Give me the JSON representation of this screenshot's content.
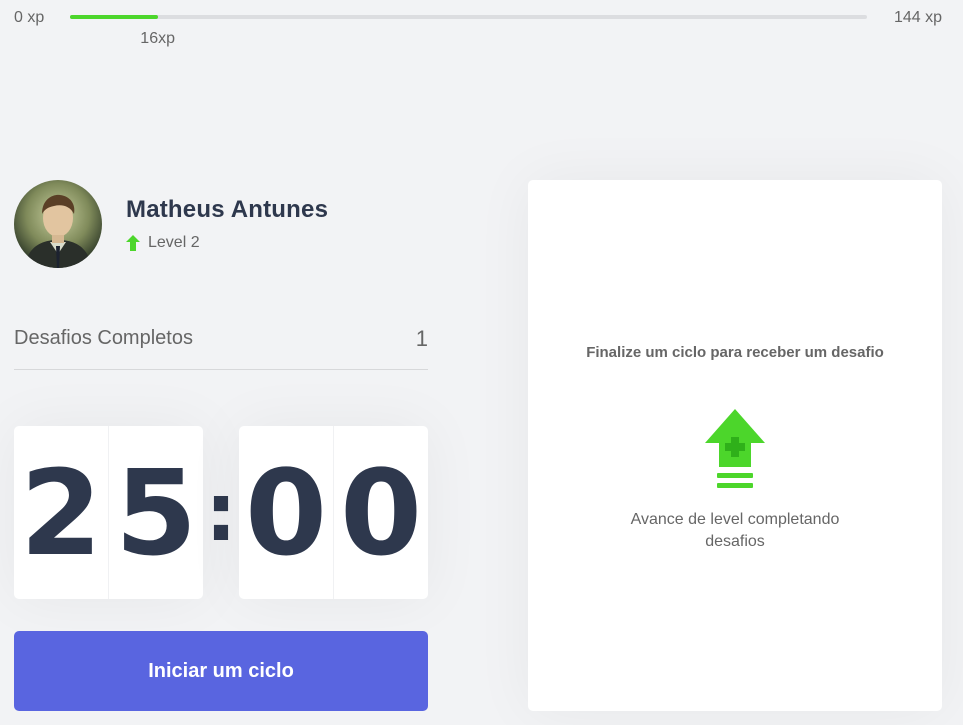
{
  "xp": {
    "min_label": "0 xp",
    "max_label": "144 xp",
    "current_label": "16xp",
    "progress": 0.11
  },
  "profile": {
    "name": "Matheus Antunes",
    "level_label": "Level 2"
  },
  "stats": {
    "completed_label": "Desafios Completos",
    "completed_count": "1"
  },
  "countdown": {
    "minute_left": "2",
    "minute_right": "5",
    "separator": ":",
    "second_left": "0",
    "second_right": "0"
  },
  "actions": {
    "start_label": "Iniciar um ciclo"
  },
  "challenge": {
    "title": "Finalize um ciclo para receber um desafio",
    "description": "Avance de level completando desafios"
  },
  "colors": {
    "accent": "#5965e0",
    "green": "#4cd62b",
    "title": "#2e384d",
    "text": "#666666",
    "background": "#f2f3f5"
  },
  "icons": [
    "level-up-arrow-icon",
    "level-up-icon"
  ]
}
